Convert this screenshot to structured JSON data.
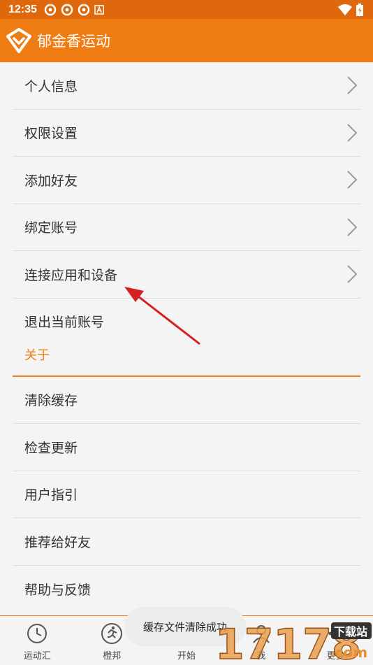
{
  "status_bar": {
    "time": "12:35"
  },
  "app_bar": {
    "title": "郁金香运动"
  },
  "menu": {
    "account_items": [
      {
        "label": "个人信息"
      },
      {
        "label": "权限设置"
      },
      {
        "label": "添加好友"
      },
      {
        "label": "绑定账号"
      },
      {
        "label": "连接应用和设备"
      }
    ],
    "logout_label": "退出当前账号",
    "about_heading": "关于",
    "about_items": [
      {
        "label": "清除缓存"
      },
      {
        "label": "检查更新"
      },
      {
        "label": "用户指引"
      },
      {
        "label": "推荐给好友"
      },
      {
        "label": "帮助与反馈"
      }
    ]
  },
  "toast": {
    "text": "缓存文件清除成功"
  },
  "bottom_nav": {
    "tabs": [
      {
        "label": "运动汇",
        "icon": "clock-icon"
      },
      {
        "label": "橙邦",
        "icon": "runner-icon"
      },
      {
        "label": "开始",
        "icon": "start-icon"
      },
      {
        "label": "我",
        "icon": "profile-icon"
      },
      {
        "label": "更多",
        "icon": "more-icon"
      }
    ]
  },
  "watermark": {
    "text": "17178",
    "site_text": "下载站",
    "domain_text": ".com"
  },
  "colors": {
    "primary": "#f07d14",
    "status_bar": "#e0680c",
    "arrow": "#d42020"
  }
}
